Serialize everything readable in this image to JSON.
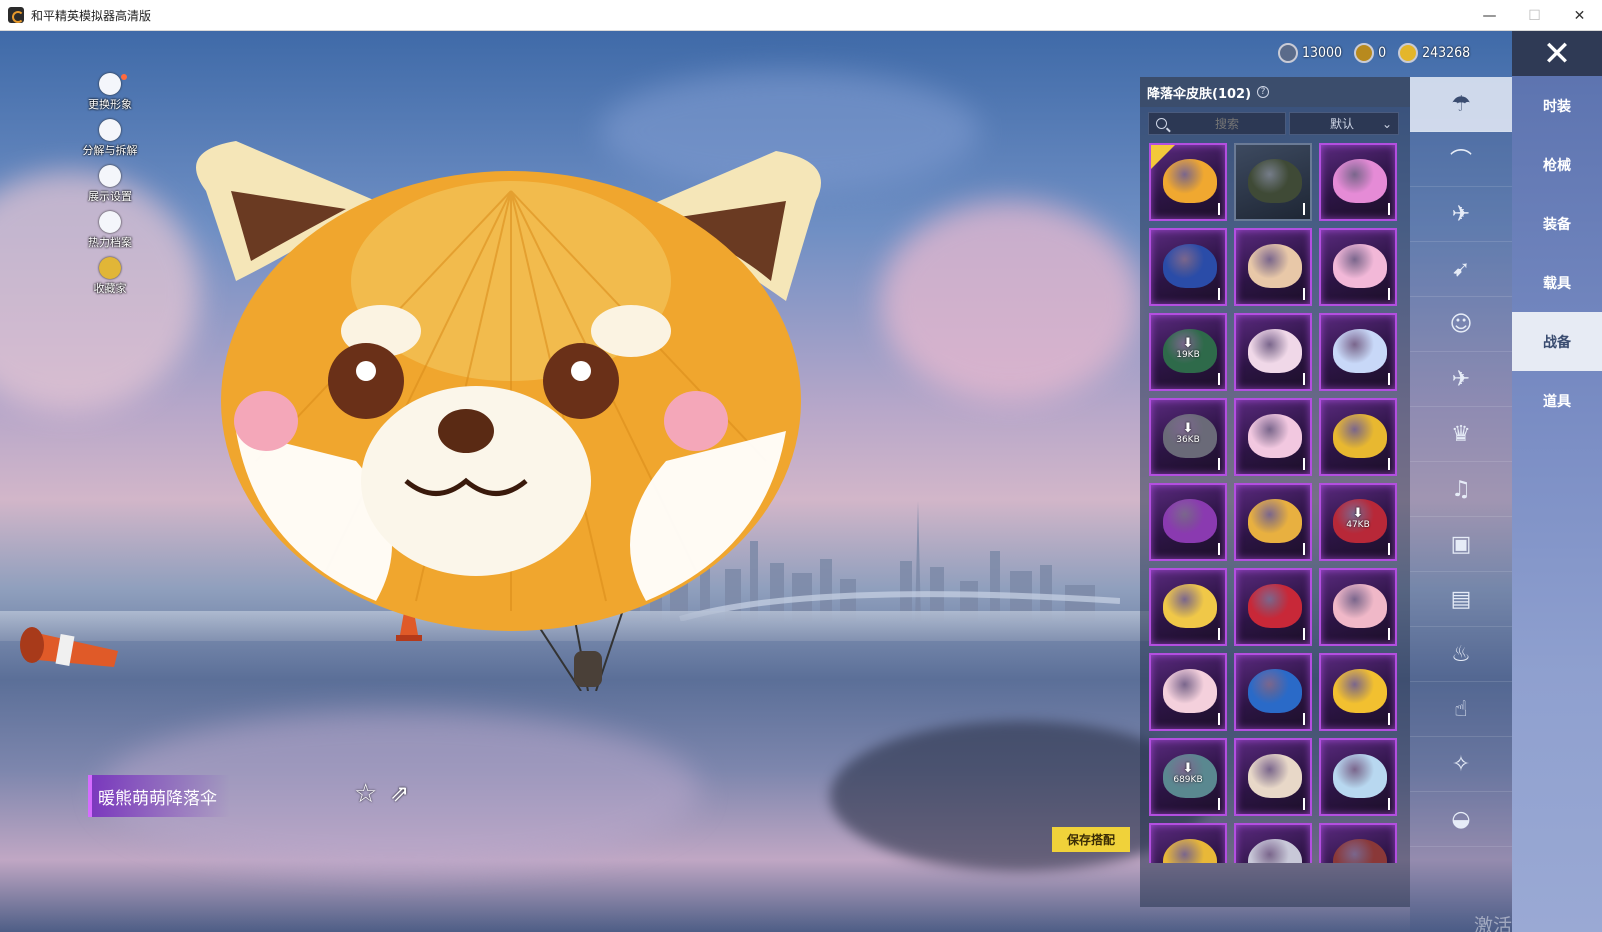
{
  "window": {
    "title": "和平精英模拟器高清版",
    "minimize": "—",
    "maximize": "☐",
    "close": "✕"
  },
  "left_menu": [
    {
      "label": "更换形象",
      "icon": "avatar-icon"
    },
    {
      "label": "分解与拆解",
      "icon": "puzzle-icon"
    },
    {
      "label": "展示设置",
      "icon": "eye-icon"
    },
    {
      "label": "热力档案",
      "icon": "flame-icon"
    },
    {
      "label": "收藏家",
      "icon": "collector-badge-icon"
    }
  ],
  "currencies": [
    {
      "value": "13000",
      "icon": "silver-coin-icon",
      "color": "#5a6b8a"
    },
    {
      "value": "0",
      "icon": "gold-token-icon",
      "color": "#b88a1e"
    },
    {
      "value": "243268",
      "icon": "gold-coin-icon",
      "color": "#e4b62a"
    }
  ],
  "panel": {
    "title": "降落伞皮肤(102)",
    "help": "?",
    "search_label": "搜索",
    "sort_label": "默认"
  },
  "tiles": [
    {
      "color": "#f0a830",
      "selected": true,
      "download": ""
    },
    {
      "color": "#3f4a36",
      "plain": true,
      "download": ""
    },
    {
      "color": "#e58bd6",
      "download": ""
    },
    {
      "color": "#2a4ca8",
      "download": ""
    },
    {
      "color": "#e8c8a8",
      "download": ""
    },
    {
      "color": "#f2b8d8",
      "download": ""
    },
    {
      "color": "#2e6a4a",
      "download": "19KB"
    },
    {
      "color": "#f0d8e8",
      "download": ""
    },
    {
      "color": "#c8d8f8",
      "download": ""
    },
    {
      "color": "#6a6a78",
      "download": "36KB"
    },
    {
      "color": "#f2c8e0",
      "download": ""
    },
    {
      "color": "#e8b830",
      "download": ""
    },
    {
      "color": "#8a3ab0",
      "download": ""
    },
    {
      "color": "#e8b040",
      "download": ""
    },
    {
      "color": "#b82838",
      "download": "47KB"
    },
    {
      "color": "#f0c848",
      "download": ""
    },
    {
      "color": "#c82838",
      "download": ""
    },
    {
      "color": "#f0b8c8",
      "download": ""
    },
    {
      "color": "#f4d0dc",
      "download": ""
    },
    {
      "color": "#2a6ac8",
      "download": ""
    },
    {
      "color": "#f2c030",
      "download": ""
    },
    {
      "color": "#5a8890",
      "download": "689KB"
    },
    {
      "color": "#e8d8c8",
      "download": ""
    },
    {
      "color": "#b8d8f0",
      "download": ""
    },
    {
      "color": "#e8b838",
      "download": ""
    },
    {
      "color": "#c8c8d8",
      "download": ""
    },
    {
      "color": "#8a3838",
      "download": ""
    }
  ],
  "icon_tabs": [
    {
      "icon": "parachute-icon",
      "glyph": "☂",
      "active": true
    },
    {
      "icon": "hat-icon",
      "glyph": "⌒"
    },
    {
      "icon": "plane-trail-icon",
      "glyph": "✈"
    },
    {
      "icon": "glider-icon",
      "glyph": "➹"
    },
    {
      "icon": "emote-face-icon",
      "glyph": "☺"
    },
    {
      "icon": "airplane-icon",
      "glyph": "✈"
    },
    {
      "icon": "robot-icon",
      "glyph": "♛"
    },
    {
      "icon": "speaker-icon",
      "glyph": "♫"
    },
    {
      "icon": "game-box-icon",
      "glyph": "▣"
    },
    {
      "icon": "photo-icon",
      "glyph": "▤"
    },
    {
      "icon": "spray-can-icon",
      "glyph": "♨"
    },
    {
      "icon": "hand-tap-icon",
      "glyph": "☝"
    },
    {
      "icon": "sparkle-wand-icon",
      "glyph": "✧"
    },
    {
      "icon": "pan-icon",
      "glyph": "◒"
    }
  ],
  "categories": [
    {
      "label": "时装"
    },
    {
      "label": "枪械"
    },
    {
      "label": "装备"
    },
    {
      "label": "载具"
    },
    {
      "label": "战备",
      "active": true
    },
    {
      "label": "道具"
    }
  ],
  "item_name": "暖熊萌萌降落伞",
  "save_button": "保存搭配",
  "watermark": "激活 Windows"
}
